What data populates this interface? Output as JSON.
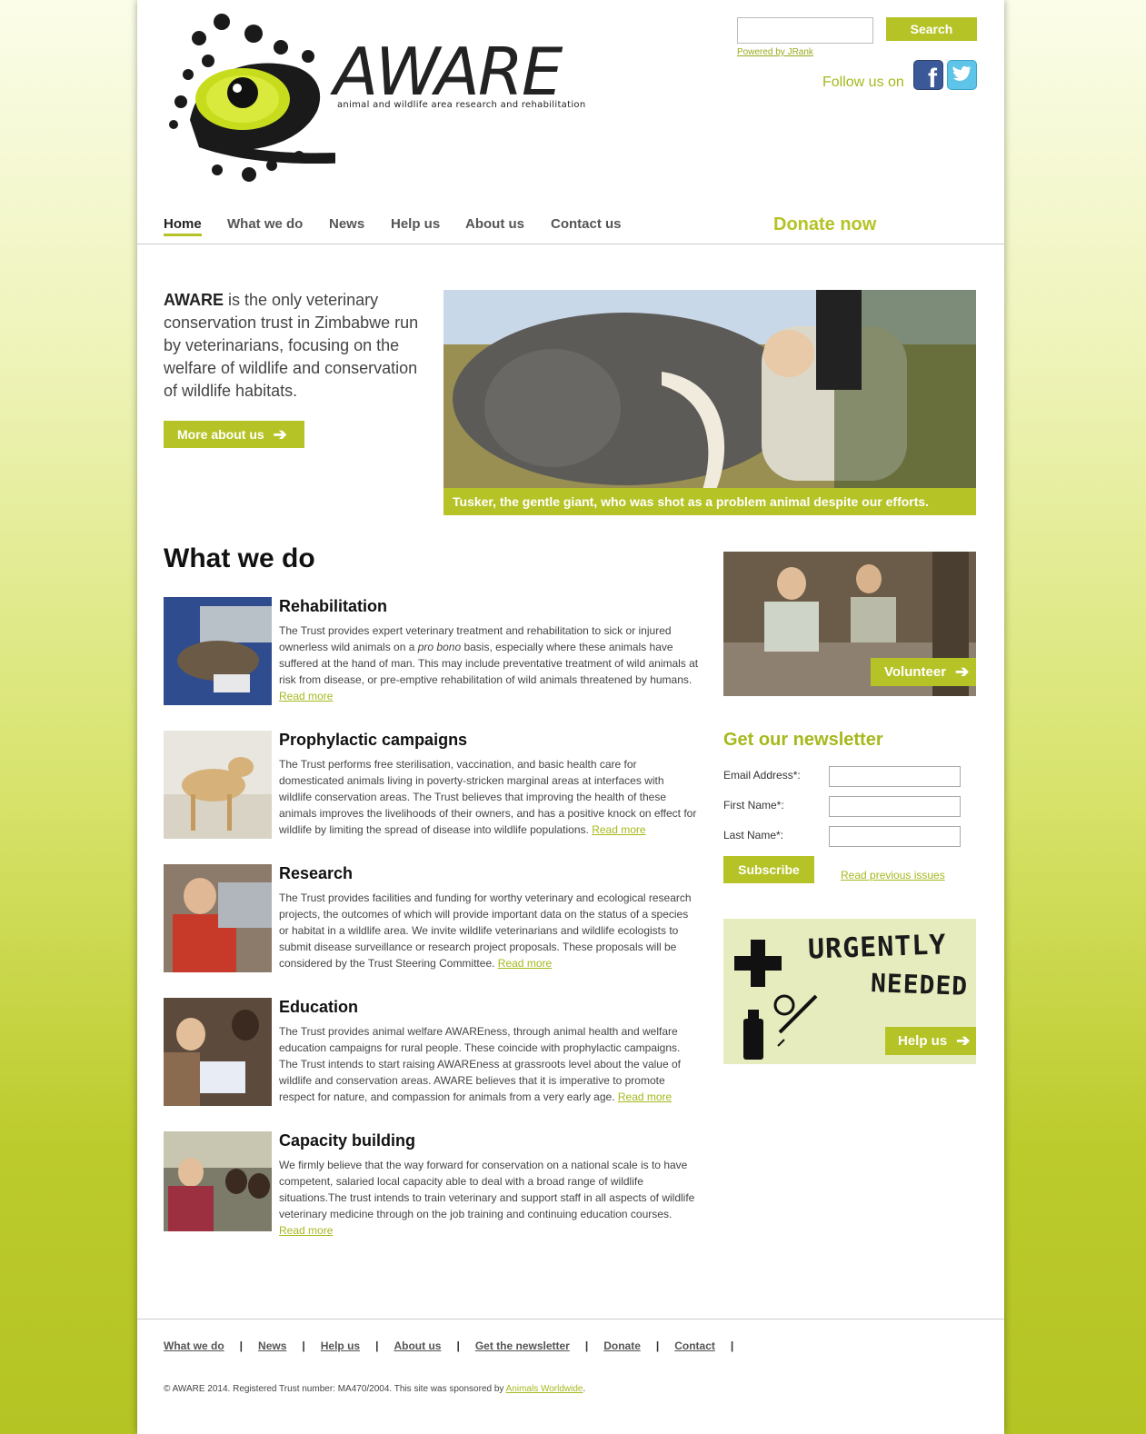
{
  "brand": {
    "name": "AWARE",
    "tagline": "animal and wildlife area research and rehabilitation",
    "accent_color": "#b5c326"
  },
  "header": {
    "search_button": "Search",
    "powered_by": "Powered by JRank",
    "follow_label": "Follow us on",
    "facebook_icon": "facebook-icon",
    "twitter_icon": "twitter-icon"
  },
  "nav": {
    "items": [
      {
        "label": "Home"
      },
      {
        "label": "What we do"
      },
      {
        "label": "News"
      },
      {
        "label": "Help us"
      },
      {
        "label": "About us"
      },
      {
        "label": "Contact us"
      }
    ],
    "donate": "Donate now"
  },
  "intro": {
    "lead": "AWARE",
    "text": " is the only veterinary conservation trust in Zimbabwe run by veterinarians, focusing on the welfare of wildlife and conservation of wildlife habitats.",
    "button": "More about us",
    "caption": "Tusker, the gentle giant, who was shot as a problem animal despite our efforts."
  },
  "what_we_do": {
    "title": "What we do",
    "read_more": "Read more",
    "items": [
      {
        "title": "Rehabilitation",
        "text_before": "The Trust provides expert veterinary treatment and rehabilitation to sick or injured ownerless wild animals on a ",
        "italic": "pro bono",
        "text_after": " basis, especially where these animals have suffered at the hand of man. This may include preventative treatment of wild animals at risk from disease, or pre-emptive rehabilitation of wild animals threatened by humans."
      },
      {
        "title": "Prophylactic campaigns",
        "text": "The Trust performs free sterilisation, vaccination, and basic health care for domesticated animals living in poverty-stricken marginal areas at interfaces with wildlife conservation areas. The Trust believes that improving the health of these animals improves the livelihoods of their owners, and has a positive knock on effect for wildlife by limiting the spread of disease into wildlife populations."
      },
      {
        "title": "Research",
        "text": "The Trust provides facilities and funding for worthy veterinary and ecological research projects, the outcomes of which will provide important data on the status of a species or habitat in a wildlife area. We invite wildlife veterinarians and wildlife ecologists to submit disease surveillance or research project proposals. These proposals will be considered by the Trust Steering Committee."
      },
      {
        "title": "Education",
        "text": "The Trust provides animal welfare AWAREness, through animal health and welfare education campaigns for rural people. These coincide with prophylactic campaigns. The Trust intends to start raising AWAREness at grassroots level about the value of wildlife and conservation areas. AWARE believes that it is imperative to promote respect for nature, and compassion for animals from a very early age."
      },
      {
        "title": "Capacity building",
        "text": "We firmly believe that the way forward for conservation on a national scale is to have competent, salaried local capacity able to deal with a broad range of wildlife situations.The trust intends to train veterinary and support staff in all aspects of wildlife veterinary medicine through on the job training and continuing education courses."
      }
    ]
  },
  "sidebar": {
    "volunteer": "Volunteer",
    "newsletter": {
      "title": "Get our newsletter",
      "email_label": "Email Address*:",
      "first_label": "First Name*:",
      "last_label": "Last Name*:",
      "subscribe": "Subscribe",
      "previous": "Read previous issues"
    },
    "urgent": {
      "line1": "URGENTLY",
      "line2": "NEEDED",
      "button": "Help us"
    }
  },
  "footer": {
    "links": [
      "What we do",
      "News",
      "Help us",
      "About us",
      "Get the newsletter",
      "Donate",
      "Contact"
    ],
    "copyright": "© AWARE 2014. Registered Trust number: MA470/2004. This site was sponsored by ",
    "sponsor": "Animals Worldwide",
    "period": "."
  }
}
